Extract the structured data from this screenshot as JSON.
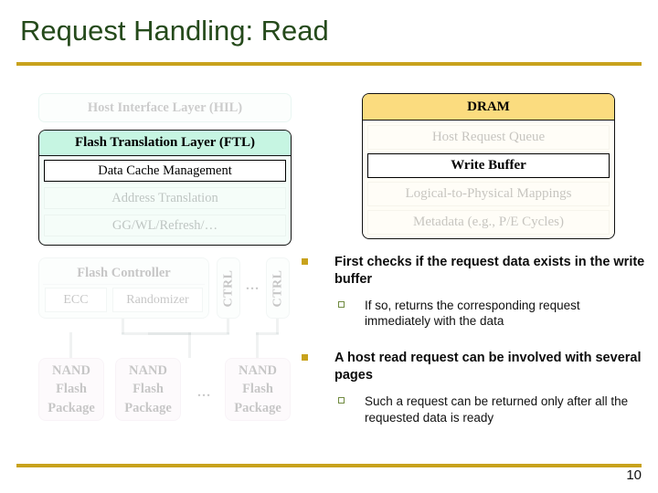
{
  "slide": {
    "title": "Request Handling: Read",
    "page_number": "10",
    "accent_color": "#c8a21c",
    "title_color": "#254a1b"
  },
  "ssd_diagram": {
    "hil": {
      "label": "Host Interface Layer (HIL)",
      "dimmed": true
    },
    "ftl": {
      "header": "Flash Translation Layer (FTL)",
      "header_color": "#c6f5e2",
      "rows": [
        {
          "label": "Data Cache Management",
          "highlighted": true
        },
        {
          "label": "Address Translation",
          "dimmed": true
        },
        {
          "label": "GG/WL/Refresh/…",
          "dimmed": true
        }
      ]
    },
    "flash_controller": {
      "header": "Flash Controller",
      "ecc": "ECC",
      "randomizer": "Randomizer",
      "dimmed": true
    },
    "controllers": [
      {
        "label": "CTRL"
      },
      {
        "label": "CTRL"
      }
    ],
    "controller_ellipsis": "…",
    "nand_packages": [
      {
        "line1": "NAND",
        "line2": "Flash",
        "line3": "Package"
      },
      {
        "line1": "NAND",
        "line2": "Flash",
        "line3": "Package"
      },
      {
        "line1": "NAND",
        "line2": "Flash",
        "line3": "Package"
      }
    ],
    "nand_ellipsis": "…",
    "nand_color": "#f7e9f3"
  },
  "dram": {
    "header": "DRAM",
    "header_color": "#fbdc7f",
    "rows": [
      {
        "label": "Host Request Queue",
        "dimmed": true
      },
      {
        "label": "Write Buffer",
        "highlighted": true
      },
      {
        "label": "Logical-to-Physical Mappings",
        "dimmed": true
      },
      {
        "label": "Metadata (e.g., P/E Cycles)",
        "dimmed": true
      }
    ]
  },
  "bullets": [
    {
      "text": "First checks if the request data exists in the write buffer",
      "sub": "If so, returns the corresponding request immediately with the data"
    },
    {
      "text": "A host read request can be involved with several pages",
      "sub": "Such a request can be returned only after all the requested data is ready"
    }
  ]
}
